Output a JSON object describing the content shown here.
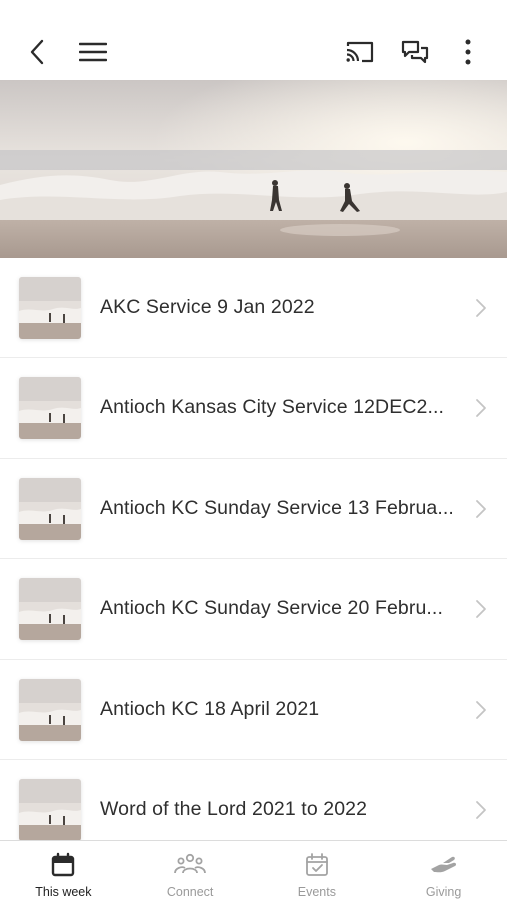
{
  "colors": {
    "icon_dark": "#2b2b2b",
    "tab_inactive": "#a3a3a3",
    "chevron": "#c4c4c4",
    "divider": "#ececec"
  },
  "toolbar": {
    "back_icon": "chevron-left-icon",
    "menu_icon": "hamburger-menu-icon",
    "cast_icon": "cast-icon",
    "chat_icon": "chat-bubbles-icon",
    "more_icon": "more-vertical-icon"
  },
  "items": [
    {
      "title": "AKC Service 9 Jan 2022"
    },
    {
      "title": "Antioch Kansas City Service 12DEC2..."
    },
    {
      "title": "Antioch KC Sunday Service 13 Februa..."
    },
    {
      "title": "Antioch KC Sunday Service 20 Febru..."
    },
    {
      "title": "Antioch KC 18 April 2021"
    },
    {
      "title": "Word of the Lord 2021 to 2022"
    }
  ],
  "tabs": [
    {
      "label": "This week",
      "icon": "calendar-icon",
      "active": true
    },
    {
      "label": "Connect",
      "icon": "people-icon",
      "active": false
    },
    {
      "label": "Events",
      "icon": "calendar-check-icon",
      "active": false
    },
    {
      "label": "Giving",
      "icon": "giving-hand-icon",
      "active": false
    }
  ]
}
